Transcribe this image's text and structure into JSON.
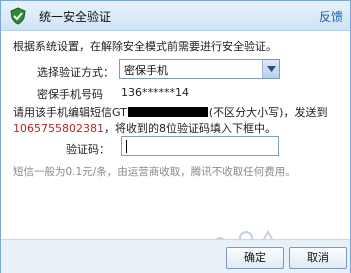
{
  "titlebar": {
    "title": "统一安全验证",
    "feedback": "反馈",
    "logo_icon": "shield-icon",
    "accent": "#1f5faa"
  },
  "intro": "根据系统设置，在解除安全模式前需要进行安全验证。",
  "form": {
    "method_label": "选择验证方式：",
    "method_value": "密保手机",
    "phone_label": "密保手机号码",
    "phone_value": "136******14",
    "code_label": "验证码："
  },
  "instruction": {
    "line1_start": "请用该手机编辑短信",
    "line1_code_prefix": "GT",
    "line1_end": "(不区分大小写)，发送到",
    "number": "1065755802381",
    "line2_end": "，将收到的8位验证码填入下框中。"
  },
  "cost_note": "短信一般为0.1元/条，由运营商收取，腾讯不收取任何费用。",
  "buttons": {
    "ok": "确定",
    "cancel": "取消"
  },
  "colors": {
    "highlight_number": "#b3262a",
    "muted": "#8a8a8a"
  }
}
